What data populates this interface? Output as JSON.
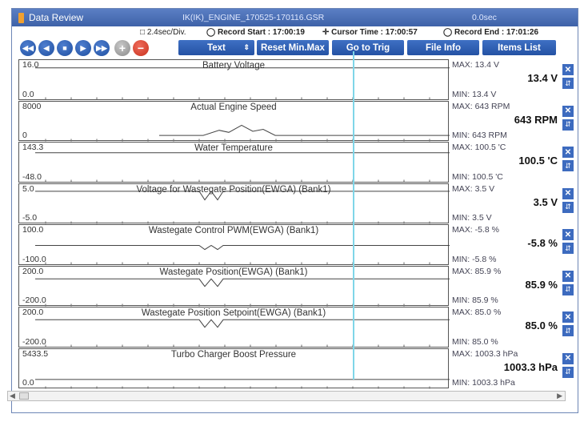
{
  "window": {
    "title": "Data Review",
    "file": "IK(IK)_ENGINE_170525-170116.GSR",
    "timer": "0.0sec"
  },
  "infobar": {
    "scale": "2.4sec/Div.",
    "record_start": "Record Start : 17:00:19",
    "cursor_time": "Cursor Time : 17:00:57",
    "record_end": "Record End : 17:01:26"
  },
  "toolbar": {
    "nav_buttons": [
      "rewind",
      "previous",
      "stop",
      "next",
      "fast-forward",
      "zoom-in",
      "zoom-out"
    ],
    "text_select": "Text",
    "reset_minmax": "Reset Min.Max",
    "go_to_trig": "Go to Trig",
    "file_info": "File Info",
    "items_list": "Items List"
  },
  "plots": [
    {
      "title": "Battery Voltage",
      "ymax": "16.0",
      "ymin": "0.0",
      "max": "MAX:  13.4 V",
      "value": "13.4 V",
      "min": "MIN:  13.4 V",
      "level": 0.84,
      "dip": 0
    },
    {
      "title": "Actual Engine Speed",
      "ymax": "8000",
      "ymin": "0",
      "max": "MAX:  643 RPM",
      "value": "643 RPM",
      "min": "MIN:  643 RPM",
      "level": 0.08,
      "bump": 0.3
    },
    {
      "title": "Water Temperature",
      "ymax": "143.3",
      "ymin": "-48.0",
      "max": "MAX: 100.5 'C",
      "value": "100.5 'C",
      "min": "MIN: 100.5 'C",
      "level": 0.77,
      "dip": 0
    },
    {
      "title": "Voltage for Wastegate Position(EWGA) (Bank1)",
      "ymax": "5.0",
      "ymin": "-5.0",
      "max": "MAX:  3.5 V",
      "value": "3.5 V",
      "min": "MIN:  3.5 V",
      "level": 0.86,
      "dip": 0.25
    },
    {
      "title": "Wastegate Control PWM(EWGA) (Bank1)",
      "ymax": "100.0",
      "ymin": "-100.0",
      "max": "MAX:  -5.8 %",
      "value": "-5.8 %",
      "min": "MIN:  -5.8 %",
      "level": 0.47,
      "dip": 0.12
    },
    {
      "title": "Wastegate Position(EWGA) (Bank1)",
      "ymax": "200.0",
      "ymin": "-200.0",
      "max": "MAX:  85.9 %",
      "value": "85.9 %",
      "min": "MIN:  85.9 %",
      "level": 0.71,
      "dip": 0.22
    },
    {
      "title": "Wastegate Position Setpoint(EWGA) (Bank1)",
      "ymax": "200.0",
      "ymin": "-200.0",
      "max": "MAX:  85.0 %",
      "value": "85.0 %",
      "min": "MIN:  85.0 %",
      "level": 0.71,
      "dip": 0.22
    },
    {
      "title": "Turbo Charger Boost Pressure",
      "ymax": "5433.5",
      "ymin": "0.0",
      "max": "MAX: 1003.3 hPa",
      "value": "1003.3 hPa",
      "min": "MIN: 1003.3 hPa",
      "level": 0.18,
      "dip": 0
    }
  ],
  "colors": {
    "titlebar": "#4a6fb5",
    "button": "#2d5cb0",
    "cursor": "#7fd6e8"
  }
}
